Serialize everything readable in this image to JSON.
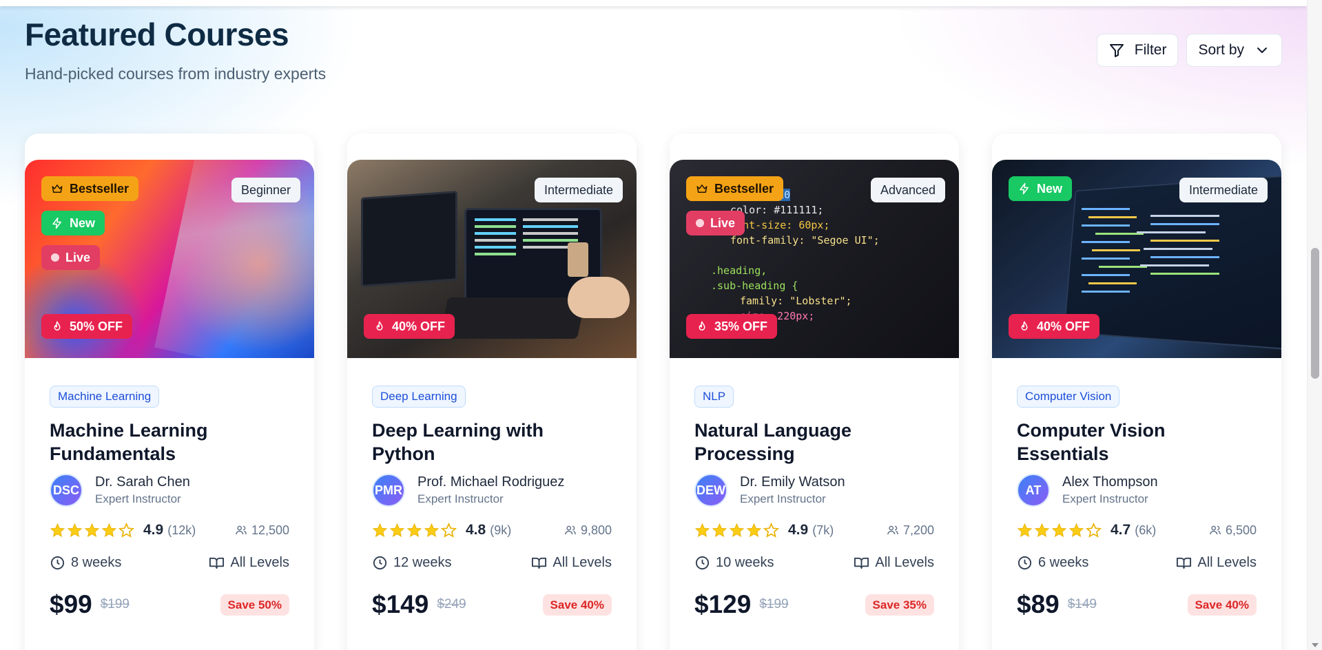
{
  "header": {
    "title": "Featured Courses",
    "subtitle": "Hand-picked courses from industry experts"
  },
  "toolbar": {
    "filter_label": "Filter",
    "sort_label": "Sort by"
  },
  "courses": [
    {
      "level": "Beginner",
      "badges": [
        "Bestseller",
        "New",
        "Live"
      ],
      "discount": "50% OFF",
      "category": "Machine Learning",
      "title": "Machine Learning Fundamentals",
      "instructor": {
        "initials": "DSC",
        "name": "Dr. Sarah Chen",
        "role": "Expert Instructor"
      },
      "rating": "4.9",
      "reviews": "(12k)",
      "students": "12,500",
      "duration": "8 weeks",
      "levels": "All Levels",
      "price": "$99",
      "old_price": "$199",
      "save": "Save 50%"
    },
    {
      "level": "Intermediate",
      "badges": [],
      "discount": "40% OFF",
      "category": "Deep Learning",
      "title": "Deep Learning with Python",
      "instructor": {
        "initials": "PMR",
        "name": "Prof. Michael Rodriguez",
        "role": "Expert Instructor"
      },
      "rating": "4.8",
      "reviews": "(9k)",
      "students": "9,800",
      "duration": "12 weeks",
      "levels": "All Levels",
      "price": "$149",
      "old_price": "$249",
      "save": "Save 40%"
    },
    {
      "level": "Advanced",
      "badges": [
        "Bestseller",
        "Live"
      ],
      "discount": "35% OFF",
      "category": "NLP",
      "title": "Natural Language Processing",
      "instructor": {
        "initials": "DEW",
        "name": "Dr. Emily Watson",
        "role": "Expert Instructor"
      },
      "rating": "4.9",
      "reviews": "(7k)",
      "students": "7,200",
      "duration": "10 weeks",
      "levels": "All Levels",
      "price": "$129",
      "old_price": "$199",
      "save": "Save 35%"
    },
    {
      "level": "Intermediate",
      "badges": [
        "New"
      ],
      "discount": "40% OFF",
      "category": "Computer Vision",
      "title": "Computer Vision Essentials",
      "instructor": {
        "initials": "AT",
        "name": "Alex Thompson",
        "role": "Expert Instructor"
      },
      "rating": "4.7",
      "reviews": "(6k)",
      "students": "6,500",
      "duration": "6 weeks",
      "levels": "All Levels",
      "price": "$89",
      "old_price": "$149",
      "save": "Save 40%"
    }
  ],
  "code_snippet": {
    "lines": [
      "color: #111111;",
      "font-size: 60px;",
      "font-family: \"Segoe UI\";",
      ".heading,",
      ".sub-heading {",
      "family: \"Lobster\";",
      "size: 220px;"
    ],
    "highlight": "#24ABE0"
  },
  "colors": {
    "title": "#0f2b44",
    "accent_blue": "#1d4ed8",
    "bestseller": "#f5a316",
    "new": "#18c964",
    "live": "#e23d63",
    "discount": "#e8224e",
    "star": "#facc15"
  },
  "icons": [
    "filter-icon",
    "chevron-down-icon",
    "crown-icon",
    "bolt-icon",
    "flame-icon",
    "star-icon",
    "users-icon",
    "clock-icon",
    "book-icon"
  ]
}
